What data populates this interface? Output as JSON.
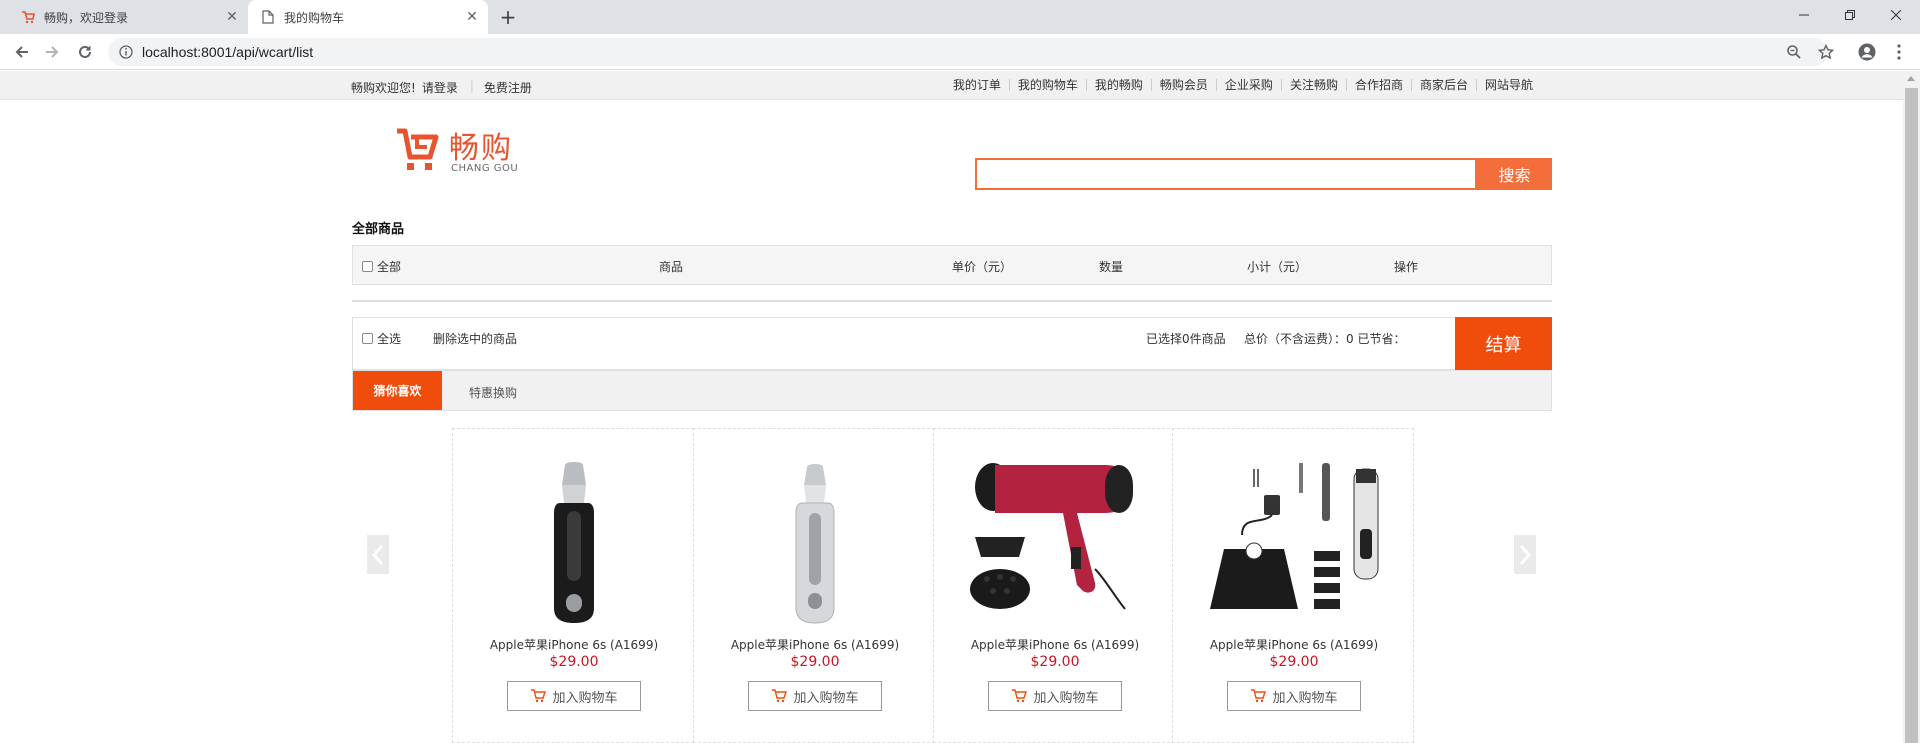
{
  "browser": {
    "tabs": [
      {
        "title": "畅购，欢迎登录",
        "active": false
      },
      {
        "title": "我的购物车",
        "active": true
      }
    ],
    "url": "localhost:8001/api/wcart/list"
  },
  "topbar": {
    "welcome": "畅购欢迎您!",
    "login": "请登录",
    "register": "免费注册",
    "links": [
      "我的订单",
      "我的购物车",
      "我的畅购",
      "畅购会员",
      "企业采购",
      "关注畅购",
      "合作招商",
      "商家后台",
      "网站导航"
    ]
  },
  "logo": {
    "cn": "畅购",
    "en": "CHANG GOU"
  },
  "search": {
    "placeholder": "",
    "button": "搜索"
  },
  "cart": {
    "title": "全部商品",
    "headers": {
      "all": "全部",
      "goods": "商品",
      "unit_price": "单价（元）",
      "qty": "数量",
      "subtotal": "小计（元）",
      "ops": "操作"
    },
    "footer": {
      "select_all": "全选",
      "delete_selected": "删除选中的商品",
      "selected_count": "已选择0件商品",
      "total": "总价（不含运费）：0 已节省：",
      "checkout": "结算"
    }
  },
  "recommend": {
    "tabs": [
      "猜你喜欢",
      "特惠换购"
    ],
    "products": [
      {
        "name": "Apple苹果iPhone 6s (A1699)",
        "price": "$29.00",
        "button": "加入购物车",
        "image": "nose-trimmer-black"
      },
      {
        "name": "Apple苹果iPhone 6s (A1699)",
        "price": "$29.00",
        "button": "加入购物车",
        "image": "nose-trimmer-silver"
      },
      {
        "name": "Apple苹果iPhone 6s (A1699)",
        "price": "$29.00",
        "button": "加入购物车",
        "image": "hair-dryer"
      },
      {
        "name": "Apple苹果iPhone 6s (A1699)",
        "price": "$29.00",
        "button": "加入购物车",
        "image": "hair-clipper-set"
      }
    ]
  },
  "colors": {
    "accent": "#f36e3a",
    "checkout": "#f04d0c",
    "price": "#c81623"
  }
}
